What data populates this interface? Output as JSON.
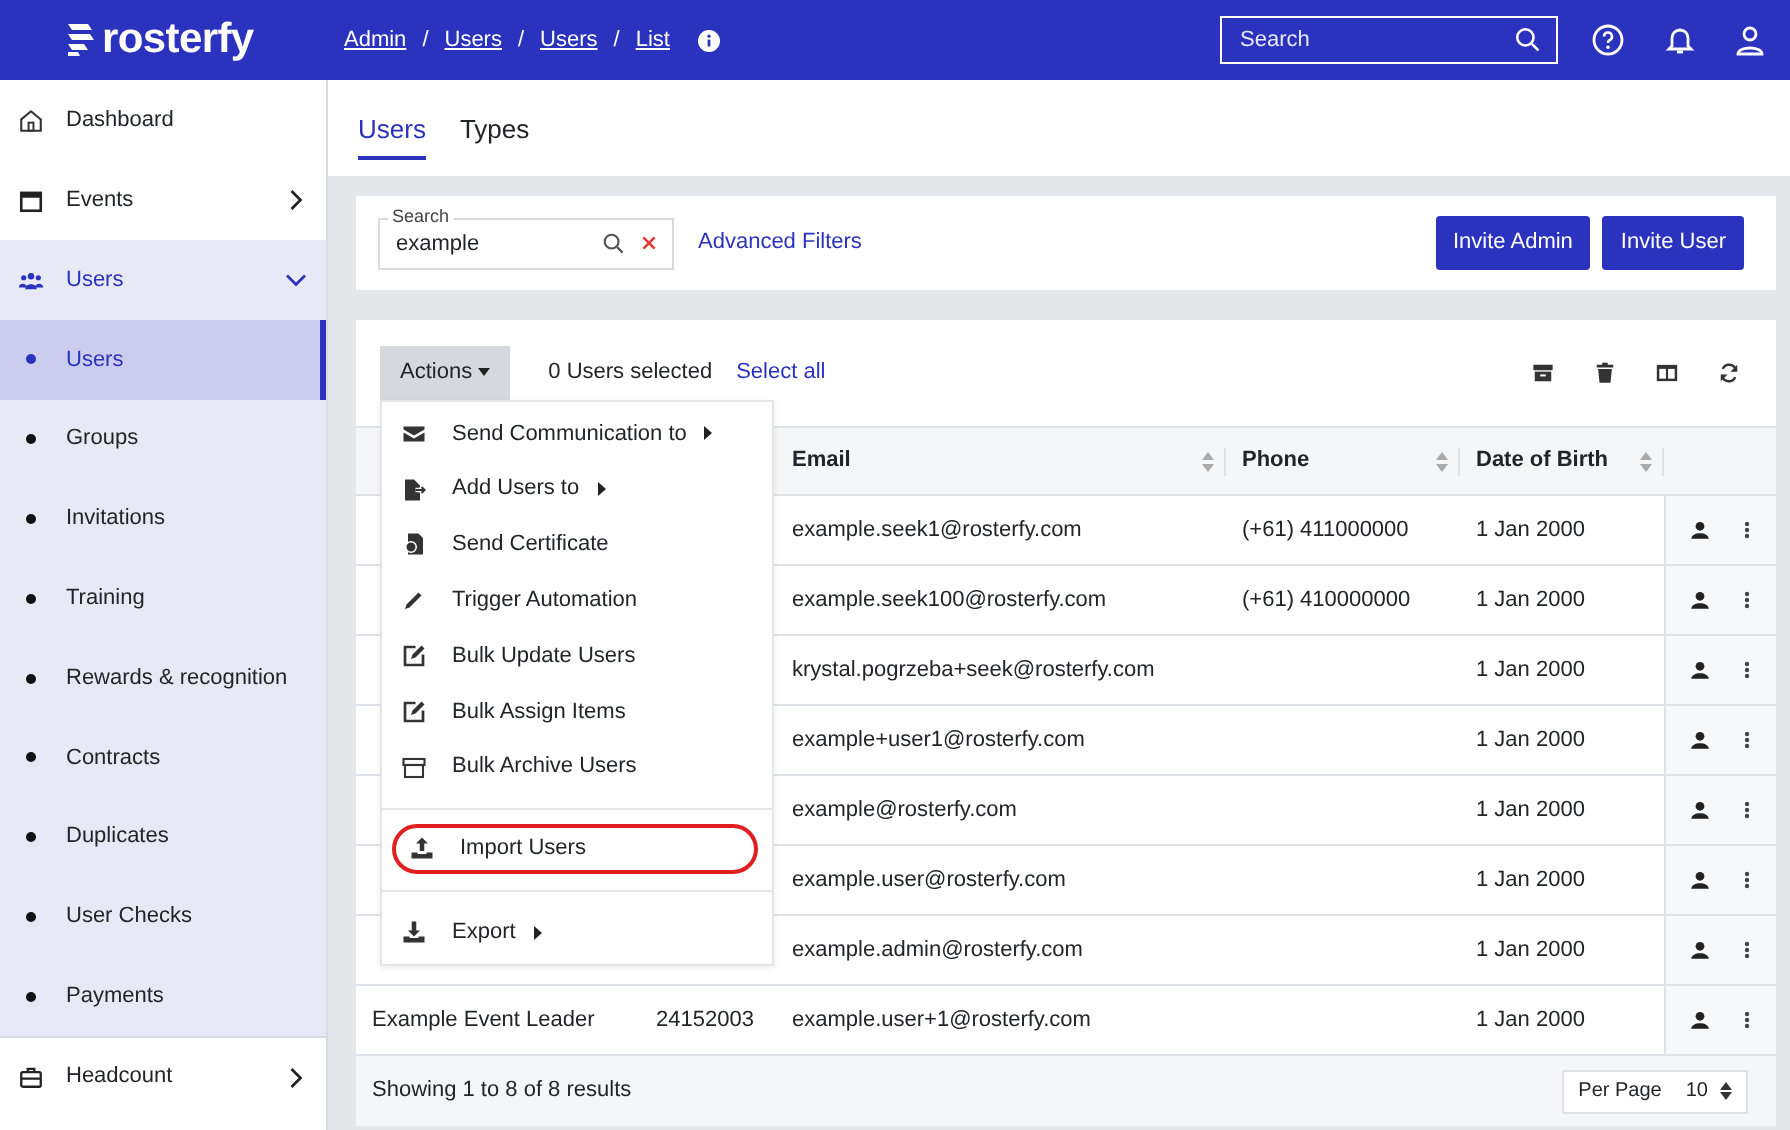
{
  "brand": "rosterfy",
  "breadcrumb": [
    {
      "label": "Admin",
      "kind": "link"
    },
    {
      "label": "/",
      "kind": "separator"
    },
    {
      "label": "Users",
      "kind": "link"
    },
    {
      "label": "/",
      "kind": "separator"
    },
    {
      "label": "Users",
      "kind": "link"
    },
    {
      "label": "/",
      "kind": "separator"
    },
    {
      "label": "List",
      "kind": "current"
    }
  ],
  "top_search": {
    "placeholder": "Search"
  },
  "sidebar": {
    "items": [
      {
        "label": "Dashboard",
        "kind": "plain"
      },
      {
        "label": "Events",
        "kind": "group",
        "expanded": false
      },
      {
        "label": "Users",
        "kind": "group",
        "expanded": true,
        "children": [
          {
            "label": "Users",
            "selected": true
          },
          {
            "label": "Groups",
            "selected": false
          },
          {
            "label": "Invitations",
            "selected": false
          },
          {
            "label": "Training",
            "selected": false
          },
          {
            "label": "Rewards & recognition",
            "selected": false
          },
          {
            "label": "Contracts",
            "selected": false
          },
          {
            "label": "Duplicates",
            "selected": false
          },
          {
            "label": "User Checks",
            "selected": false
          },
          {
            "label": "Payments",
            "selected": false
          }
        ]
      },
      {
        "label": "Headcount",
        "kind": "group",
        "expanded": false
      }
    ]
  },
  "tabs": [
    {
      "label": "Users",
      "selected": true
    },
    {
      "label": "Types",
      "selected": false
    }
  ],
  "filters": {
    "search": {
      "label": "Search",
      "value": "example"
    },
    "advanced_link": "Advanced Filters",
    "buttons": [
      "Invite Admin",
      "Invite User"
    ]
  },
  "toolbar": {
    "actions_button": "Actions",
    "selection_count": "0 Users selected",
    "select_all": "Select all"
  },
  "actions_menu": [
    {
      "label": "Send Communication to",
      "submenu": true,
      "highlighted": false
    },
    {
      "label": "Add Users to",
      "submenu": true,
      "highlighted": false
    },
    {
      "label": "Send Certificate",
      "submenu": false,
      "highlighted": false
    },
    {
      "label": "Trigger Automation",
      "submenu": false,
      "highlighted": false
    },
    {
      "label": "Bulk Update Users",
      "submenu": false,
      "highlighted": false
    },
    {
      "label": "Bulk Assign Items",
      "submenu": false,
      "highlighted": false
    },
    {
      "label": "Bulk Archive Users",
      "submenu": false,
      "highlighted": false,
      "divider_after": true
    },
    {
      "label": "Import Users",
      "submenu": false,
      "highlighted": true,
      "divider_after": true
    },
    {
      "label": "Export",
      "submenu": true,
      "highlighted": false
    }
  ],
  "table": {
    "columns": [
      {
        "label": "Email",
        "sortable": true
      },
      {
        "label": "Phone",
        "sortable": true
      },
      {
        "label": "Date of Birth",
        "sortable": true
      }
    ],
    "rows": [
      {
        "email": "example.seek1@rosterfy.com",
        "phone": "(+61) 411000000",
        "dob": "1 Jan 2000"
      },
      {
        "email": "example.seek100@rosterfy.com",
        "phone": "(+61) 410000000",
        "dob": "1 Jan 2000"
      },
      {
        "email": "krystal.pogrzeba+seek@rosterfy.com",
        "dob": "1 Jan 2000"
      },
      {
        "email": "example+user1@rosterfy.com",
        "dob": "1 Jan 2000"
      },
      {
        "email": "example@rosterfy.com",
        "dob": "1 Jan 2000"
      },
      {
        "email": "example.user@rosterfy.com",
        "dob": "1 Jan 2000"
      },
      {
        "email": "example.admin@rosterfy.com",
        "dob": "1 Jan 2000"
      },
      {
        "column_1": "Example Event Leader",
        "column_2": "24152003",
        "email": "example.user+1@rosterfy.com",
        "dob": "1 Jan 2000"
      }
    ]
  },
  "footer": {
    "summary": "Showing 1 to 8 of 8 results",
    "per_page_label": "Per Page",
    "per_page_value": "10"
  }
}
